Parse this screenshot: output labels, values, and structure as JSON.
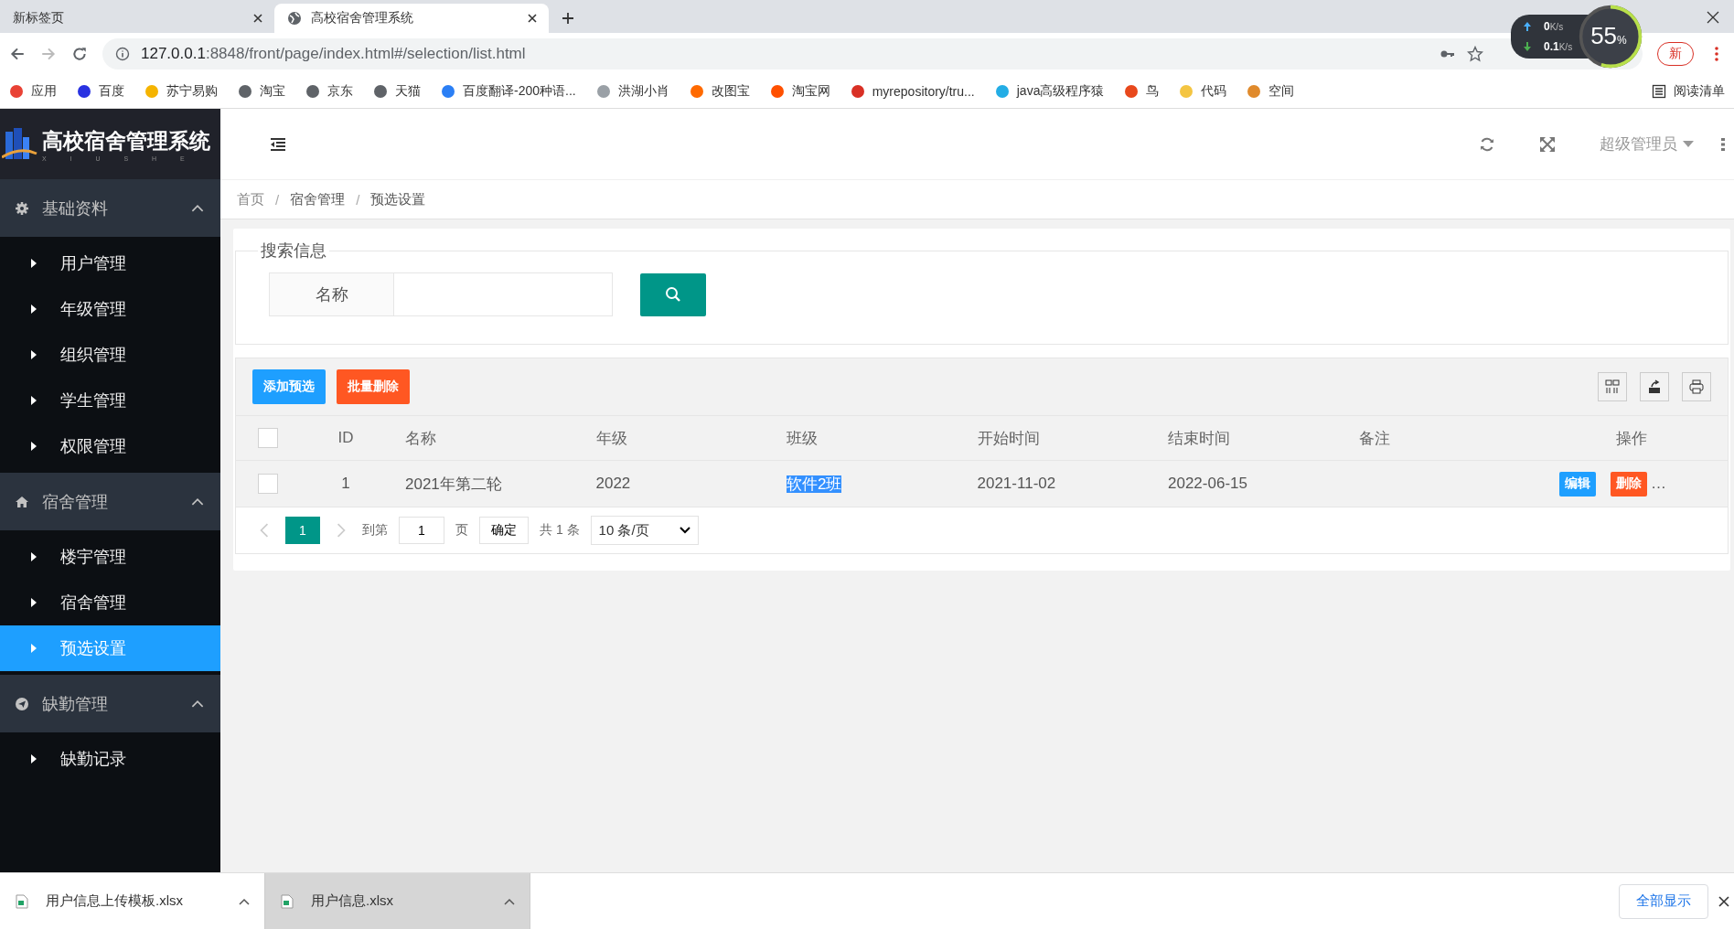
{
  "browser": {
    "tabs": [
      {
        "title": "新标签页",
        "selected": false
      },
      {
        "title": "高校宿舍管理系统",
        "selected": true
      }
    ],
    "url_host": "127.0.0.1",
    "url_rest": ":8848/front/page/index.html#/selection/list.html",
    "update_label": "新",
    "bookmarks": [
      {
        "label": "应用",
        "color": "#e94235"
      },
      {
        "label": "百度",
        "color": "#2932e1"
      },
      {
        "label": "苏宁易购",
        "color": "#f5b400"
      },
      {
        "label": "淘宝",
        "color": "#5f6368"
      },
      {
        "label": "京东",
        "color": "#5f6368"
      },
      {
        "label": "天猫",
        "color": "#5f6368"
      },
      {
        "label": "百度翻译-200种语...",
        "color": "#2b7ff5"
      },
      {
        "label": "洪湖小肖",
        "color": "#9aa0a6"
      },
      {
        "label": "改图宝",
        "color": "#ff6a00"
      },
      {
        "label": "淘宝网",
        "color": "#ff5000"
      },
      {
        "label": "myrepository/tru...",
        "color": "#d93025"
      },
      {
        "label": "java高级程序猿",
        "color": "#23ade5"
      },
      {
        "label": "鸟",
        "color": "#e8481c"
      },
      {
        "label": "代码",
        "color": "#f4c542"
      },
      {
        "label": "空间",
        "color": "#e08a2c"
      }
    ],
    "reading_list": "阅读清单"
  },
  "speed_widget": {
    "up": "0",
    "up_unit": "K/s",
    "down": "0.1",
    "down_unit": "K/s",
    "percent": "55",
    "percent_unit": "%",
    "level": 0.55
  },
  "app": {
    "logo_title": "高校宿舍管理系统",
    "logo_subtitle": "X I U S H E",
    "sidebar": [
      {
        "label": "基础资料",
        "expanded": true,
        "children": [
          {
            "label": "用户管理",
            "selected": false
          },
          {
            "label": "年级管理",
            "selected": false
          },
          {
            "label": "组织管理",
            "selected": false
          },
          {
            "label": "学生管理",
            "selected": false
          },
          {
            "label": "权限管理",
            "selected": false
          }
        ]
      },
      {
        "label": "宿舍管理",
        "expanded": true,
        "children": [
          {
            "label": "楼宇管理",
            "selected": false
          },
          {
            "label": "宿舍管理",
            "selected": false
          },
          {
            "label": "预选设置",
            "selected": true
          }
        ]
      },
      {
        "label": "缺勤管理",
        "expanded": true,
        "children": [
          {
            "label": "缺勤记录",
            "selected": false
          }
        ]
      }
    ],
    "user": "超级管理员",
    "breadcrumb": [
      "首页",
      "宿舍管理",
      "预选设置"
    ],
    "breadcrumb_separator": "/",
    "search": {
      "legend": "搜索信息",
      "label": "名称"
    },
    "toolbar": [
      {
        "label": "添加预选",
        "kind": "primary"
      },
      {
        "label": "批量删除",
        "kind": "danger"
      }
    ],
    "table": {
      "columns": [
        "ID",
        "名称",
        "年级",
        "班级",
        "开始时间",
        "结束时间",
        "备注",
        "操作"
      ],
      "header_checked": false,
      "rows": [
        {
          "checked": false,
          "cells": [
            {
              "text": "1",
              "highlighted": false
            },
            {
              "text": "2021年第二轮",
              "highlighted": false
            },
            {
              "text": "2022",
              "highlighted": false
            },
            {
              "text": "软件2班",
              "highlighted": true
            },
            {
              "text": "2021-11-02",
              "highlighted": false
            },
            {
              "text": "2022-06-15",
              "highlighted": false
            }
          ],
          "actions": [
            {
              "label": "编辑",
              "kind": "primary"
            },
            {
              "label": "删除",
              "kind": "danger"
            }
          ],
          "more": "…"
        }
      ]
    },
    "pagination": {
      "pages": [
        {
          "label": "1",
          "selected": true
        }
      ],
      "goto_label": "到第",
      "goto_value": "1",
      "page_unit": "页",
      "confirm": "确定",
      "total": "共 1 条",
      "per_page": "10 条/页"
    }
  },
  "downloads": {
    "items": [
      {
        "name": "用户信息上传模板.xlsx",
        "selected": false
      },
      {
        "name": "用户信息.xlsx",
        "selected": true
      }
    ],
    "show_all": "全部显示"
  }
}
